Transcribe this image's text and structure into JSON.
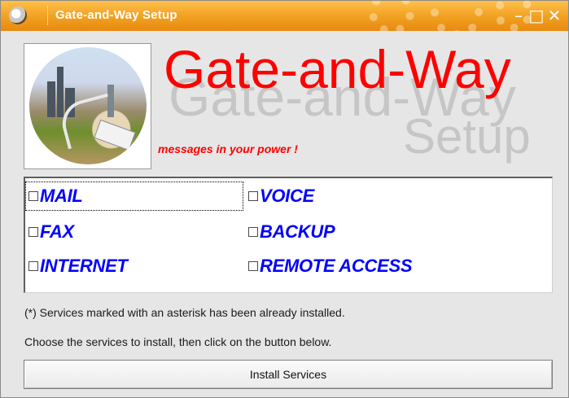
{
  "window": {
    "title": "Gate-and-Way Setup",
    "accent_color": "#f0a020",
    "controls": {
      "minimize_icon": "minimize-icon",
      "maximize_icon": "maximize-icon",
      "close_icon": "close-icon"
    }
  },
  "banner": {
    "brand": "Gate-and-Way",
    "subtitle": "Setup",
    "tagline": "messages in your power !",
    "brand_color": "#ff0000"
  },
  "services": {
    "label_color": "#0000ff",
    "items": [
      {
        "label": "MAIL",
        "checked": false
      },
      {
        "label": "VOICE",
        "checked": false
      },
      {
        "label": "FAX",
        "checked": false
      },
      {
        "label": "BACKUP",
        "checked": false
      },
      {
        "label": "INTERNET",
        "checked": false
      },
      {
        "label": "REMOTE ACCESS",
        "checked": false
      }
    ]
  },
  "notes": {
    "asterisk": "(*) Services marked with an asterisk has been already installed.",
    "instruction": "Choose the services to install, then click on the button below."
  },
  "actions": {
    "install_label": "Install Services"
  }
}
